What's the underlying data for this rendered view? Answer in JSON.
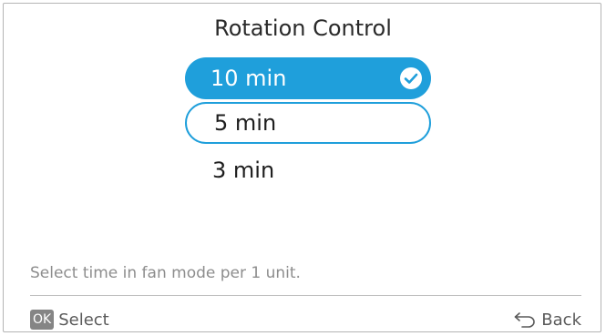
{
  "title": "Rotation Control",
  "options": [
    {
      "label": "10 min",
      "state": "selected"
    },
    {
      "label": "5 min",
      "state": "focused"
    },
    {
      "label": "3 min",
      "state": "normal"
    }
  ],
  "hint": "Select time in fan mode per 1 unit.",
  "footer": {
    "ok_badge": "OK",
    "select_label": "Select",
    "back_label": "Back"
  },
  "icons": {
    "check": "check-circle-icon",
    "back": "back-arrow-icon"
  },
  "colors": {
    "accent": "#1f9fdb",
    "badge": "#858585"
  }
}
